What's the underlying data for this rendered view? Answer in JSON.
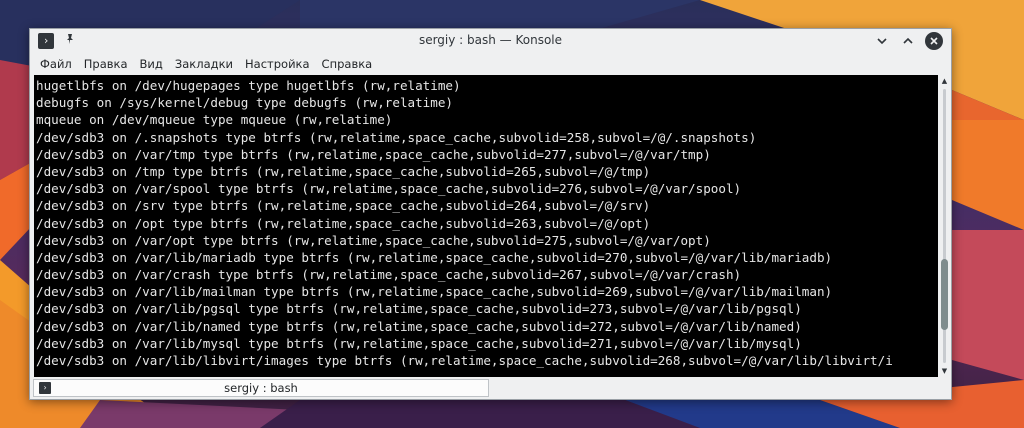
{
  "window": {
    "title": "sergiy : bash — Konsole",
    "app_icon_glyph": "›",
    "pin_icon_glyph": "📌"
  },
  "menubar": {
    "items": [
      "Файл",
      "Правка",
      "Вид",
      "Закладки",
      "Настройка",
      "Справка"
    ]
  },
  "terminal": {
    "lines": [
      "hugetlbfs on /dev/hugepages type hugetlbfs (rw,relatime)",
      "debugfs on /sys/kernel/debug type debugfs (rw,relatime)",
      "mqueue on /dev/mqueue type mqueue (rw,relatime)",
      "/dev/sdb3 on /.snapshots type btrfs (rw,relatime,space_cache,subvolid=258,subvol=/@/.snapshots)",
      "/dev/sdb3 on /var/tmp type btrfs (rw,relatime,space_cache,subvolid=277,subvol=/@/var/tmp)",
      "/dev/sdb3 on /tmp type btrfs (rw,relatime,space_cache,subvolid=265,subvol=/@/tmp)",
      "/dev/sdb3 on /var/spool type btrfs (rw,relatime,space_cache,subvolid=276,subvol=/@/var/spool)",
      "/dev/sdb3 on /srv type btrfs (rw,relatime,space_cache,subvolid=264,subvol=/@/srv)",
      "/dev/sdb3 on /opt type btrfs (rw,relatime,space_cache,subvolid=263,subvol=/@/opt)",
      "/dev/sdb3 on /var/opt type btrfs (rw,relatime,space_cache,subvolid=275,subvol=/@/var/opt)",
      "/dev/sdb3 on /var/lib/mariadb type btrfs (rw,relatime,space_cache,subvolid=270,subvol=/@/var/lib/mariadb)",
      "/dev/sdb3 on /var/crash type btrfs (rw,relatime,space_cache,subvolid=267,subvol=/@/var/crash)",
      "/dev/sdb3 on /var/lib/mailman type btrfs (rw,relatime,space_cache,subvolid=269,subvol=/@/var/lib/mailman)",
      "/dev/sdb3 on /var/lib/pgsql type btrfs (rw,relatime,space_cache,subvolid=273,subvol=/@/var/lib/pgsql)",
      "/dev/sdb3 on /var/lib/named type btrfs (rw,relatime,space_cache,subvolid=272,subvol=/@/var/lib/named)",
      "/dev/sdb3 on /var/lib/mysql type btrfs (rw,relatime,space_cache,subvolid=271,subvol=/@/var/lib/mysql)",
      "/dev/sdb3 on /var/lib/libvirt/images type btrfs (rw,relatime,space_cache,subvolid=268,subvol=/@/var/lib/libvirt/i"
    ],
    "scroll_thumb_start_fraction": 0.62,
    "scroll_thumb_size_fraction": 0.26
  },
  "tabs": [
    {
      "label": "sergiy : bash",
      "icon_glyph": "›"
    }
  ],
  "colors": {
    "terminal_bg": "#000000",
    "terminal_fg": "#e6e6e6",
    "chrome_bg": "#eff0f1"
  }
}
